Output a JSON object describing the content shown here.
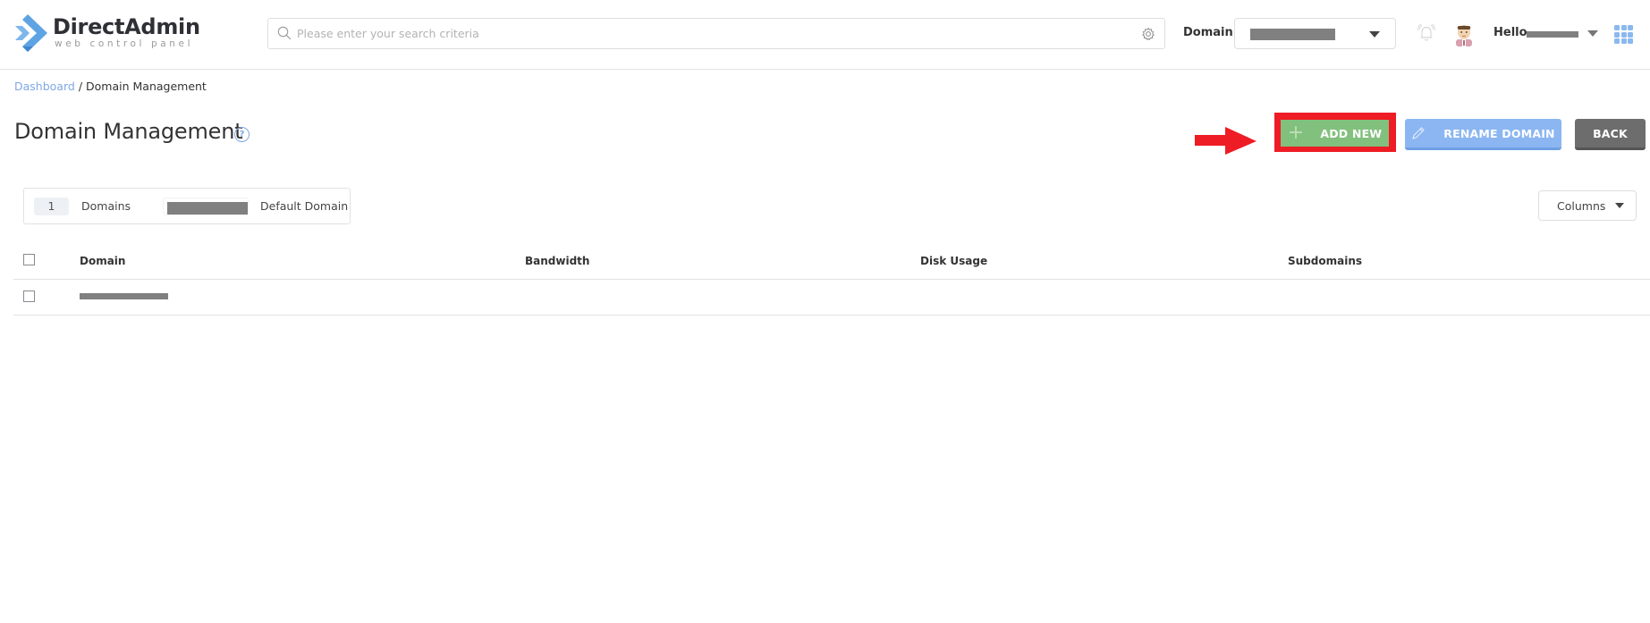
{
  "header": {
    "logo_title": "DirectAdmin",
    "logo_subtitle": "web control panel",
    "search_placeholder": "Please enter your search criteria",
    "search_value": "",
    "domain_label": "Domain",
    "domain_selected": "[redacted]",
    "greeting": "Hello,",
    "username": "[redacted]",
    "icons": [
      "search-icon",
      "gear-icon",
      "bell-icon",
      "avatar",
      "chevron-down-icon",
      "apps-grid-icon"
    ]
  },
  "breadcrumb": {
    "items": [
      "Dashboard",
      "Domain Management"
    ],
    "separator": "/"
  },
  "page": {
    "title": "Domain Management",
    "help_icon": "?"
  },
  "toolbar": {
    "add_label": "ADD NEW",
    "add_icon": "+",
    "rename_label": "RENAME DOMAIN",
    "back_label": "BACK"
  },
  "stats": {
    "domain_count": "1",
    "domains_label": "Domains",
    "default_domain_value": "[redacted]",
    "default_domain_label": "Default Domain"
  },
  "columns_button": {
    "label": "Columns"
  },
  "table": {
    "columns": [
      "Domain",
      "Bandwidth",
      "Disk Usage",
      "Subdomains"
    ],
    "rows": [
      {
        "domain": "[redacted]",
        "bandwidth": "",
        "disk_usage": "",
        "subdomains": ""
      }
    ]
  },
  "annotation": {
    "highlight_color": "#ee1c24",
    "target": "ADD NEW"
  },
  "colors": {
    "add_button": "#82c07e",
    "rename_button": "#8bb6f2",
    "back_button": "#6d6d6d",
    "link": "#7fa8e6",
    "logo_blue": "#5ea3e3"
  }
}
